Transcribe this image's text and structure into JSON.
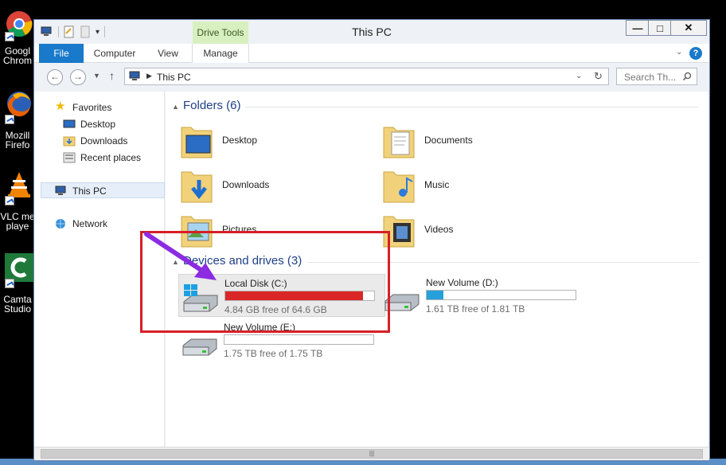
{
  "desktop": {
    "icons": [
      {
        "label": "Googl\nChrom",
        "icon": "chrome-icon"
      },
      {
        "label": "Mozill\nFirefo",
        "icon": "firefox-icon"
      },
      {
        "label": "VLC me\nplaye",
        "icon": "vlc-icon"
      },
      {
        "label": "Camta\nStudio",
        "icon": "camtasia-icon"
      }
    ]
  },
  "window": {
    "title": "This PC",
    "context_tab": "Drive Tools",
    "controls": {
      "minimize": "—",
      "maximize": "□",
      "close": "✕"
    }
  },
  "ribbon": {
    "tabs": [
      {
        "label": "File"
      },
      {
        "label": "Computer"
      },
      {
        "label": "View"
      },
      {
        "label": "Manage"
      }
    ],
    "help": "?"
  },
  "address": {
    "path": "This PC",
    "search_placeholder": "Search Th..."
  },
  "navpane": {
    "favorites": "Favorites",
    "favorite_items": [
      "Desktop",
      "Downloads",
      "Recent places"
    ],
    "this_pc": "This PC",
    "network": "Network"
  },
  "folders": {
    "header": "Folders (6)",
    "items": [
      "Desktop",
      "Documents",
      "Downloads",
      "Music",
      "Pictures",
      "Videos"
    ]
  },
  "drives": {
    "header": "Devices and drives (3)",
    "items": [
      {
        "name": "Local Disk (C:)",
        "free": "4.84 GB free of 64.6 GB",
        "used_fraction": 0.925,
        "bar_color": "#da2626"
      },
      {
        "name": "New Volume (D:)",
        "free": "1.61 TB free of 1.81 TB",
        "used_fraction": 0.11,
        "bar_color": "#26a0da"
      },
      {
        "name": "New Volume (E:)",
        "free": "1.75 TB free of 1.75 TB",
        "used_fraction": 0.0,
        "bar_color": "#26a0da"
      }
    ]
  },
  "colors": {
    "accent": "#1979ca",
    "annotation": "#d61f26",
    "arrow": "#8b2be2"
  }
}
